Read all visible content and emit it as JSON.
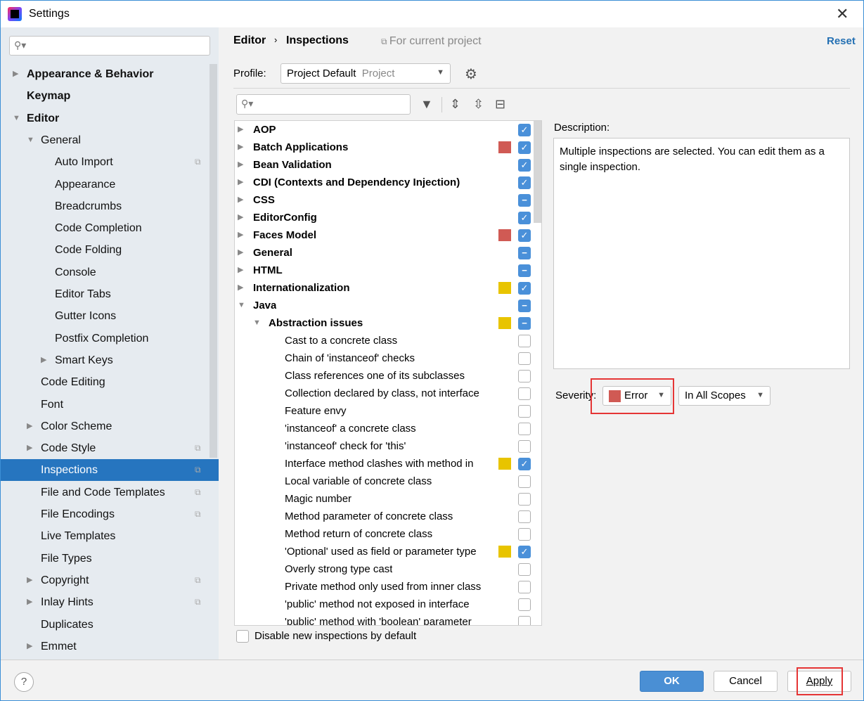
{
  "window": {
    "title": "Settings"
  },
  "sidebar": {
    "items": [
      {
        "label": "Appearance & Behavior",
        "level": 0,
        "bold": true,
        "arrow": "right"
      },
      {
        "label": "Keymap",
        "level": 0,
        "bold": true
      },
      {
        "label": "Editor",
        "level": 0,
        "bold": true,
        "arrow": "down"
      },
      {
        "label": "General",
        "level": 1,
        "arrow": "down"
      },
      {
        "label": "Auto Import",
        "level": 2,
        "copy": true
      },
      {
        "label": "Appearance",
        "level": 2
      },
      {
        "label": "Breadcrumbs",
        "level": 2
      },
      {
        "label": "Code Completion",
        "level": 2
      },
      {
        "label": "Code Folding",
        "level": 2
      },
      {
        "label": "Console",
        "level": 2
      },
      {
        "label": "Editor Tabs",
        "level": 2
      },
      {
        "label": "Gutter Icons",
        "level": 2
      },
      {
        "label": "Postfix Completion",
        "level": 2
      },
      {
        "label": "Smart Keys",
        "level": 2,
        "arrow": "right"
      },
      {
        "label": "Code Editing",
        "level": 1
      },
      {
        "label": "Font",
        "level": 1
      },
      {
        "label": "Color Scheme",
        "level": 1,
        "arrow": "right"
      },
      {
        "label": "Code Style",
        "level": 1,
        "arrow": "right",
        "copy": true
      },
      {
        "label": "Inspections",
        "level": 1,
        "copy": true,
        "selected": true
      },
      {
        "label": "File and Code Templates",
        "level": 1,
        "copy": true
      },
      {
        "label": "File Encodings",
        "level": 1,
        "copy": true
      },
      {
        "label": "Live Templates",
        "level": 1
      },
      {
        "label": "File Types",
        "level": 1
      },
      {
        "label": "Copyright",
        "level": 1,
        "arrow": "right",
        "copy": true
      },
      {
        "label": "Inlay Hints",
        "level": 1,
        "arrow": "right",
        "copy": true
      },
      {
        "label": "Duplicates",
        "level": 1
      },
      {
        "label": "Emmet",
        "level": 1,
        "arrow": "right"
      }
    ]
  },
  "breadcrumb": {
    "parent": "Editor",
    "current": "Inspections",
    "scope": "For current project"
  },
  "reset_label": "Reset",
  "profile": {
    "label": "Profile:",
    "value": "Project Default",
    "kind": "Project"
  },
  "tree": {
    "rows": [
      {
        "label": "AOP",
        "level": 0,
        "bold": true,
        "arrow": "right",
        "state": "on"
      },
      {
        "label": "Batch Applications",
        "level": 0,
        "bold": true,
        "arrow": "right",
        "state": "on",
        "color": "#d05a54"
      },
      {
        "label": "Bean Validation",
        "level": 0,
        "bold": true,
        "arrow": "right",
        "state": "on"
      },
      {
        "label": "CDI (Contexts and Dependency Injection)",
        "level": 0,
        "bold": true,
        "arrow": "right",
        "state": "on"
      },
      {
        "label": "CSS",
        "level": 0,
        "bold": true,
        "arrow": "right",
        "state": "mix"
      },
      {
        "label": "EditorConfig",
        "level": 0,
        "bold": true,
        "arrow": "right",
        "state": "on"
      },
      {
        "label": "Faces Model",
        "level": 0,
        "bold": true,
        "arrow": "right",
        "state": "on",
        "color": "#d05a54"
      },
      {
        "label": "General",
        "level": 0,
        "bold": true,
        "arrow": "right",
        "state": "mix"
      },
      {
        "label": "HTML",
        "level": 0,
        "bold": true,
        "arrow": "right",
        "state": "mix"
      },
      {
        "label": "Internationalization",
        "level": 0,
        "bold": true,
        "arrow": "right",
        "state": "on",
        "color": "#e8c400"
      },
      {
        "label": "Java",
        "level": 0,
        "bold": true,
        "arrow": "down",
        "state": "mix"
      },
      {
        "label": "Abstraction issues",
        "level": 1,
        "bold": true,
        "arrow": "down",
        "state": "mix",
        "color": "#e8c400"
      },
      {
        "label": "Cast to a concrete class",
        "level": 2,
        "state": "off"
      },
      {
        "label": "Chain of 'instanceof' checks",
        "level": 2,
        "state": "off"
      },
      {
        "label": "Class references one of its subclasses",
        "level": 2,
        "state": "off"
      },
      {
        "label": "Collection declared by class, not interface",
        "level": 2,
        "state": "off"
      },
      {
        "label": "Feature envy",
        "level": 2,
        "state": "off"
      },
      {
        "label": "'instanceof' a concrete class",
        "level": 2,
        "state": "off"
      },
      {
        "label": "'instanceof' check for 'this'",
        "level": 2,
        "state": "off"
      },
      {
        "label": "Interface method clashes with method in",
        "level": 2,
        "state": "on",
        "color": "#e8c400"
      },
      {
        "label": "Local variable of concrete class",
        "level": 2,
        "state": "off"
      },
      {
        "label": "Magic number",
        "level": 2,
        "state": "off"
      },
      {
        "label": "Method parameter of concrete class",
        "level": 2,
        "state": "off"
      },
      {
        "label": "Method return of concrete class",
        "level": 2,
        "state": "off"
      },
      {
        "label": "'Optional' used as field or parameter type",
        "level": 2,
        "state": "on",
        "color": "#e8c400"
      },
      {
        "label": "Overly strong type cast",
        "level": 2,
        "state": "off"
      },
      {
        "label": "Private method only used from inner class",
        "level": 2,
        "state": "off"
      },
      {
        "label": "'public' method not exposed in interface",
        "level": 2,
        "state": "off"
      },
      {
        "label": "'public' method with 'boolean' parameter",
        "level": 2,
        "state": "off"
      }
    ]
  },
  "description": {
    "label": "Description:",
    "text": "Multiple inspections are selected. You can edit them as a single inspection."
  },
  "severity": {
    "label": "Severity:",
    "value": "Error",
    "color": "#d05a54",
    "scope": "In All Scopes"
  },
  "disable_new_label": "Disable new inspections by default",
  "buttons": {
    "help": "?",
    "ok": "OK",
    "cancel": "Cancel",
    "apply": "Apply"
  }
}
